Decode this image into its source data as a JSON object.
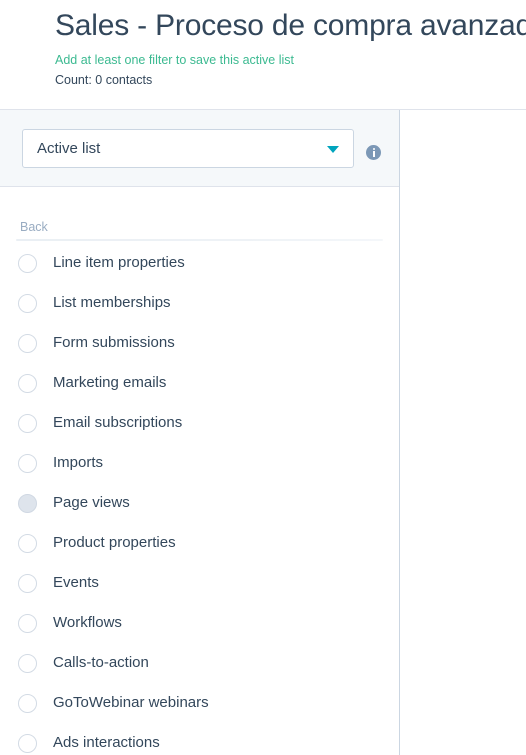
{
  "header": {
    "title": "Sales - Proceso de compra avanzado",
    "subtitle": "Add at least one filter to save this active list",
    "count_text": "Count: 0 contacts"
  },
  "filter_bar": {
    "list_type_value": "Active list",
    "caret_icon": "chevron-down-icon",
    "info_icon": "info-icon",
    "accent_caret_color": "#00a4bd",
    "info_icon_color": "#7c98b6"
  },
  "panel": {
    "back_label": "Back",
    "items": [
      {
        "label": "Line item properties",
        "selected": false
      },
      {
        "label": "List memberships",
        "selected": false
      },
      {
        "label": "Form submissions",
        "selected": false
      },
      {
        "label": "Marketing emails",
        "selected": false
      },
      {
        "label": "Email subscriptions",
        "selected": false
      },
      {
        "label": "Imports",
        "selected": false
      },
      {
        "label": "Page views",
        "selected": true
      },
      {
        "label": "Product properties",
        "selected": false
      },
      {
        "label": "Events",
        "selected": false
      },
      {
        "label": "Workflows",
        "selected": false
      },
      {
        "label": "Calls-to-action",
        "selected": false
      },
      {
        "label": "GoToWebinar webinars",
        "selected": false
      },
      {
        "label": "Ads interactions",
        "selected": false
      }
    ]
  },
  "colors": {
    "title": "#33475b",
    "success_text": "#3cba91",
    "muted_text": "#99acc2",
    "panel_bg": "#f5f8fa",
    "border": "#cbd6e2"
  }
}
